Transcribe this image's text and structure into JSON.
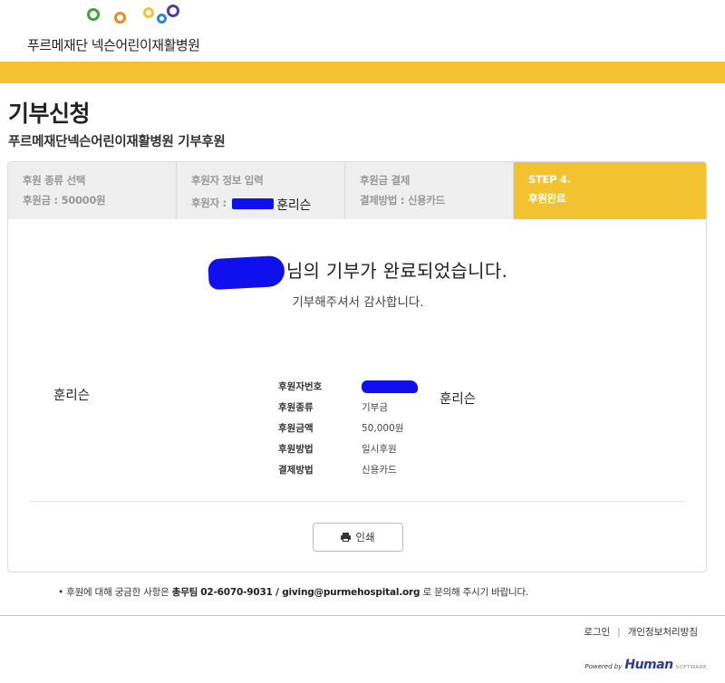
{
  "header": {
    "org_name": "푸르메재단 넥슨어린이재활병원",
    "logo_colors": [
      "#3fa33a",
      "#f08a1c",
      "#f3c231",
      "#1f8ed8",
      "#4b3fa8"
    ]
  },
  "page": {
    "title": "기부신청",
    "subtitle": "푸르메재단넥슨어린이재활병원 기부후원"
  },
  "steps": [
    {
      "title": "후원 종류 선택",
      "detail": "후원금 : 50000원",
      "active": false
    },
    {
      "title": "후원자 정보 입력",
      "detail_label": "후원자 :",
      "detail_name": "훈리슨",
      "active": false
    },
    {
      "title": "후원금 결제",
      "detail": "결제방법 : 신용카드",
      "active": false
    },
    {
      "title": "STEP 4.",
      "detail": "후원완료",
      "active": true
    }
  ],
  "completion": {
    "message": "님의 기부가 완료되었습니다.",
    "thanks": "기부해주셔서 감사합니다."
  },
  "donor": {
    "name_left": "훈리슨",
    "name_right": "훈리슨"
  },
  "details": [
    {
      "label": "후원자번호",
      "value": ""
    },
    {
      "label": "후원종류",
      "value": "기부금"
    },
    {
      "label": "후원금액",
      "value": "50,000원"
    },
    {
      "label": "후원방법",
      "value": "일시후원"
    },
    {
      "label": "결제방법",
      "value": "신용카드"
    }
  ],
  "print_button": {
    "label": "인쇄",
    "icon": "printer-icon"
  },
  "contact": {
    "prefix": "• 후원에 대해 궁금한 사항은",
    "team": "총무팀",
    "phone_email": "02-6070-9031 / giving@purmehospital.org",
    "suffix": "로 문의해 주시기 바랍니다."
  },
  "footer": {
    "login": "로그인",
    "separator": "|",
    "privacy": "개인정보처리방침",
    "powered_by": "Powered by",
    "brand": "Human",
    "brand_suffix": "SOFTWARE"
  },
  "colors": {
    "accent_yellow": "#f3c231",
    "redaction_blue": "#1010ee"
  }
}
